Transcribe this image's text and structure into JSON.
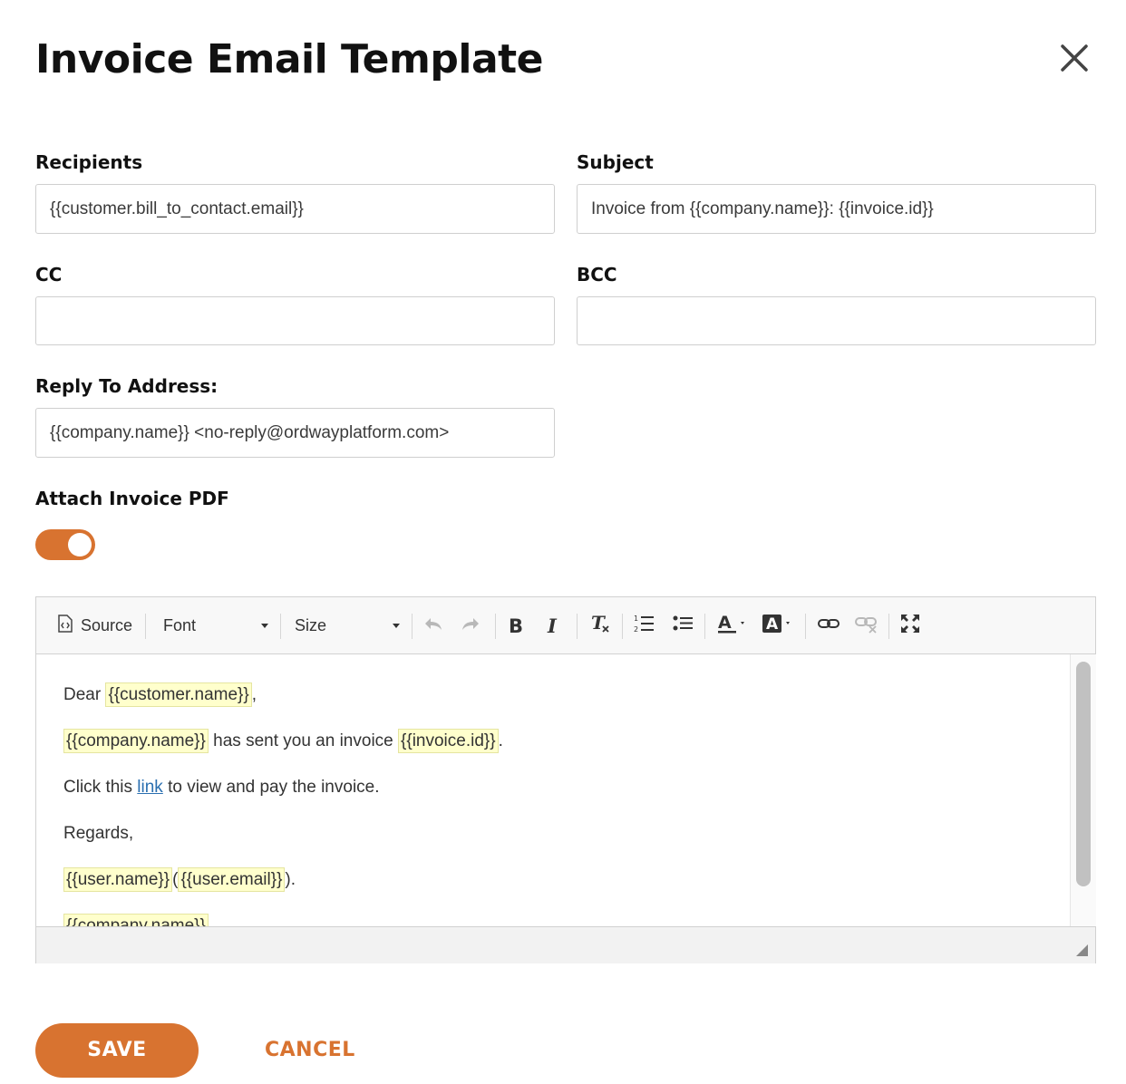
{
  "dialog": {
    "title": "Invoice Email Template"
  },
  "fields": {
    "recipients": {
      "label": "Recipients",
      "value": "{{customer.bill_to_contact.email}}"
    },
    "subject": {
      "label": "Subject",
      "value": "Invoice from {{company.name}}: {{invoice.id}}"
    },
    "cc": {
      "label": "CC",
      "value": ""
    },
    "bcc": {
      "label": "BCC",
      "value": ""
    },
    "reply_to": {
      "label": "Reply To Address:",
      "value": "{{company.name}} <no-reply@ordwayplatform.com>"
    }
  },
  "attach_pdf": {
    "label": "Attach Invoice PDF",
    "enabled": true
  },
  "toolbar": {
    "source": "Source",
    "font": "Font",
    "size": "Size"
  },
  "body": {
    "dear": "Dear",
    "customer_name": "{{customer.name}}",
    "comma": ",",
    "company_name": "{{company.name}}",
    "has_sent": "has sent you an invoice",
    "invoice_id": "{{invoice.id}}",
    "period": ".",
    "click_this": "Click this",
    "link": "link",
    "to_view": "to view and pay the invoice.",
    "regards": "Regards,",
    "user_name": "{{user.name}}",
    "open_paren": "(",
    "user_email": "{{user.email}}",
    "close_paren": ").",
    "company_name_footer": "{{company.name}}"
  },
  "actions": {
    "save": "SAVE",
    "cancel": "CANCEL"
  },
  "colors": {
    "accent": "#d87330",
    "placeholder_highlight": "#ffffcc",
    "link": "#2a6fb0"
  }
}
